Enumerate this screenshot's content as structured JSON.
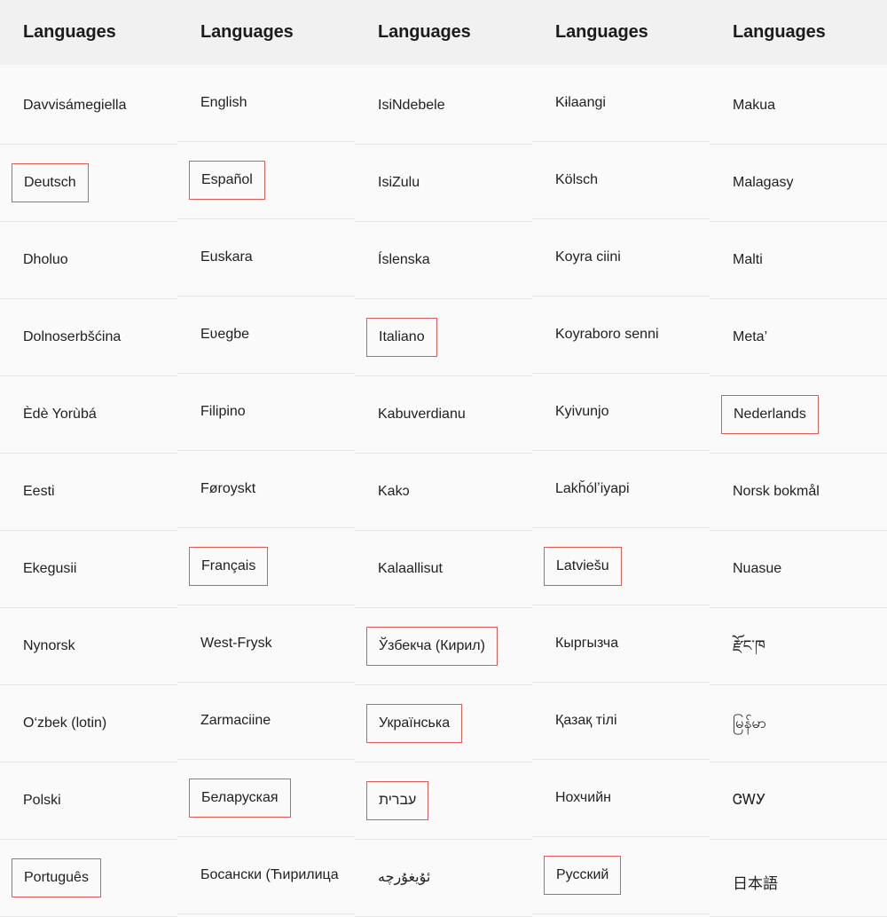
{
  "table": {
    "column_header_label": "Languages",
    "columns": [
      {
        "header": "Languages",
        "cells": [
          {
            "label": "Davvisámegiella",
            "boxed": false
          },
          {
            "label": "Deutsch",
            "boxed": true
          },
          {
            "label": "Dholuo",
            "boxed": false
          },
          {
            "label": "Dolnoserbšćina",
            "boxed": false
          },
          {
            "label": "Èdè Yorùbá",
            "boxed": false
          },
          {
            "label": "Eesti",
            "boxed": false
          },
          {
            "label": "Ekegusii",
            "boxed": false
          },
          {
            "label": "Nynorsk",
            "boxed": false
          },
          {
            "label": "O‘zbek (lotin)",
            "boxed": false
          },
          {
            "label": "Polski",
            "boxed": false
          },
          {
            "label": "Português",
            "boxed": true
          }
        ]
      },
      {
        "header": "Languages",
        "cells": [
          {
            "label": "English",
            "boxed": false
          },
          {
            "label": "Español",
            "boxed": true
          },
          {
            "label": "Euskara",
            "boxed": false
          },
          {
            "label": "Eʋegbe",
            "boxed": false
          },
          {
            "label": "Filipino",
            "boxed": false
          },
          {
            "label": "Føroyskt",
            "boxed": false
          },
          {
            "label": "Français",
            "boxed": true
          },
          {
            "label": "West-Frysk",
            "boxed": false
          },
          {
            "label": "Zarmaciine",
            "boxed": false
          },
          {
            "label": "Беларуская",
            "boxed": true
          },
          {
            "label": "Босански (Ћирилица",
            "boxed": false,
            "overflow": true
          }
        ]
      },
      {
        "header": "Languages",
        "cells": [
          {
            "label": "IsiNdebele",
            "boxed": false
          },
          {
            "label": "IsiZulu",
            "boxed": false
          },
          {
            "label": "Íslenska",
            "boxed": false
          },
          {
            "label": "Italiano",
            "boxed": true
          },
          {
            "label": "Kabuverdianu",
            "boxed": false
          },
          {
            "label": "Kakɔ",
            "boxed": false
          },
          {
            "label": "Kalaallisut",
            "boxed": false
          },
          {
            "label": "Ўзбекча (Кирил)",
            "boxed": true
          },
          {
            "label": "Українська",
            "boxed": true
          },
          {
            "label": "עברית",
            "boxed": true,
            "rtl": true
          },
          {
            "label": "ئۇيغۇرچە",
            "boxed": false,
            "rtl": true
          }
        ]
      },
      {
        "header": "Languages",
        "cells": [
          {
            "label": "Kɨlaangi",
            "boxed": false
          },
          {
            "label": "Kölsch",
            "boxed": false
          },
          {
            "label": "Koyra ciini",
            "boxed": false
          },
          {
            "label": "Koyraboro senni",
            "boxed": false
          },
          {
            "label": "Kyivunjo",
            "boxed": false
          },
          {
            "label": "Lakȟólʼiyapi",
            "boxed": false
          },
          {
            "label": "Latviešu",
            "boxed": true
          },
          {
            "label": "Кыргызча",
            "boxed": false
          },
          {
            "label": "Қазақ тілі",
            "boxed": false
          },
          {
            "label": "Нохчийн",
            "boxed": false
          },
          {
            "label": "Русский",
            "boxed": true
          }
        ]
      },
      {
        "header": "Languages",
        "cells": [
          {
            "label": "Makua",
            "boxed": false
          },
          {
            "label": "Malagasy",
            "boxed": false
          },
          {
            "label": "Malti",
            "boxed": false
          },
          {
            "label": "Meta’",
            "boxed": false
          },
          {
            "label": "Nederlands",
            "boxed": true
          },
          {
            "label": "Norsk bokmål",
            "boxed": false
          },
          {
            "label": "Nuasue",
            "boxed": false
          },
          {
            "label": "རྫོང་ཁ",
            "boxed": false,
            "script": "tall"
          },
          {
            "label": "မြန်မာ",
            "boxed": false,
            "script": "tall"
          },
          {
            "label": "ᏣᎳᎩ",
            "boxed": false
          },
          {
            "label": "日本語",
            "boxed": false,
            "script": "cjk"
          }
        ]
      }
    ]
  },
  "colors": {
    "header_background": "#f1f1f1",
    "body_background": "#fafafa",
    "row_divider": "#e8e8e8",
    "highlight_border": "#df5b53",
    "text": "#202124"
  }
}
